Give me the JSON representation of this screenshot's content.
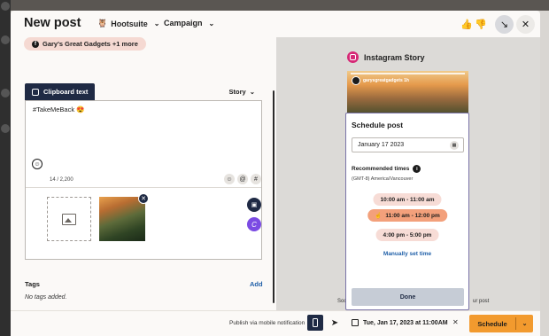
{
  "header": {
    "title": "New post",
    "org_dropdown": "Hootsuite",
    "campaign_dropdown": "Campaign"
  },
  "composer": {
    "account_chip": "Gary's Great Gadgets +1 more",
    "tab_label": "Clipboard text",
    "format_dropdown": "Story",
    "post_text": "#TakeMeBack 😍",
    "char_count": "14 / 2,200",
    "tags_label": "Tags",
    "tags_add": "Add",
    "tags_empty": "No tags added."
  },
  "preview": {
    "network_title": "Instagram Story",
    "profile_name": "garysgreatgadgets 1h",
    "caption_left": "Social n",
    "caption_right": "ur post"
  },
  "schedule_panel": {
    "title": "Schedule post",
    "date_value": "January 17 2023",
    "recommended_label": "Recommended times",
    "timezone": "(GMT-8) America/Vancouver",
    "slots": [
      {
        "label": "10:00 am - 11:00 am",
        "selected": false
      },
      {
        "label": "11:00 am - 12:00 pm",
        "selected": true
      },
      {
        "label": "4:00 pm - 5:00 pm",
        "selected": false
      }
    ],
    "manual_link": "Manually set time",
    "done_label": "Done"
  },
  "footer": {
    "publish_via": "Publish via mobile notification",
    "scheduled_datetime": "Tue, Jan 17, 2023 at 11:00AM",
    "schedule_button": "Schedule"
  },
  "colors": {
    "navy": "#1f2a44",
    "schedule_orange": "#f29a2e",
    "slot_selected": "#f3a07b",
    "link_blue": "#1f5fa8"
  }
}
